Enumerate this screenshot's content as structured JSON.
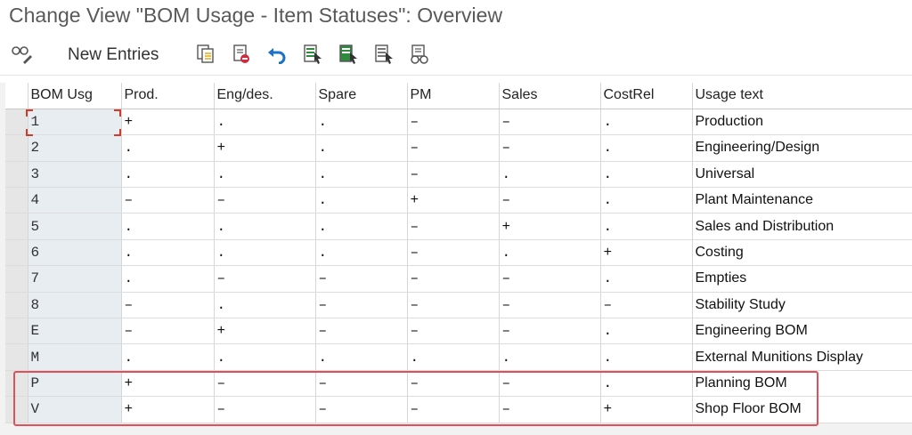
{
  "window": {
    "title": "Change View \"BOM Usage - Item Statuses\": Overview"
  },
  "toolbar": {
    "new_entries_label": "New Entries",
    "icons": [
      "display-change-icon",
      "copy-icon",
      "delete-icon",
      "undo-icon",
      "select-all-icon",
      "select-block-icon",
      "deselect-all-icon",
      "print-icon"
    ]
  },
  "table": {
    "columns": [
      "BOM Usg",
      "Prod.",
      "Eng/des.",
      "Spare",
      "PM",
      "Sales",
      "CostRel",
      "Usage text"
    ],
    "rows": [
      {
        "key": "1",
        "prod": "+",
        "eng": ".",
        "spare": ".",
        "pm": "–",
        "sales": "–",
        "cost": ".",
        "text": "Production"
      },
      {
        "key": "2",
        "prod": ".",
        "eng": "+",
        "spare": ".",
        "pm": "–",
        "sales": "–",
        "cost": ".",
        "text": "Engineering/Design"
      },
      {
        "key": "3",
        "prod": ".",
        "eng": ".",
        "spare": ".",
        "pm": "–",
        "sales": ".",
        "cost": ".",
        "text": "Universal"
      },
      {
        "key": "4",
        "prod": "–",
        "eng": "–",
        "spare": ".",
        "pm": "+",
        "sales": "–",
        "cost": ".",
        "text": "Plant Maintenance"
      },
      {
        "key": "5",
        "prod": ".",
        "eng": ".",
        "spare": ".",
        "pm": "–",
        "sales": "+",
        "cost": ".",
        "text": "Sales and Distribution"
      },
      {
        "key": "6",
        "prod": ".",
        "eng": ".",
        "spare": ".",
        "pm": "–",
        "sales": ".",
        "cost": "+",
        "text": "Costing"
      },
      {
        "key": "7",
        "prod": ".",
        "eng": "–",
        "spare": "–",
        "pm": "–",
        "sales": "–",
        "cost": ".",
        "text": "Empties"
      },
      {
        "key": "8",
        "prod": "–",
        "eng": ".",
        "spare": "–",
        "pm": "–",
        "sales": "–",
        "cost": "–",
        "text": "Stability Study"
      },
      {
        "key": "E",
        "prod": "–",
        "eng": "+",
        "spare": "–",
        "pm": "–",
        "sales": "–",
        "cost": ".",
        "text": "Engineering BOM"
      },
      {
        "key": "M",
        "prod": ".",
        "eng": ".",
        "spare": ".",
        "pm": ".",
        "sales": ".",
        "cost": ".",
        "text": "External Munitions Display"
      },
      {
        "key": "P",
        "prod": "+",
        "eng": "–",
        "spare": "–",
        "pm": "–",
        "sales": "–",
        "cost": ".",
        "text": "Planning BOM"
      },
      {
        "key": "V",
        "prod": "+",
        "eng": "–",
        "spare": "–",
        "pm": "–",
        "sales": "–",
        "cost": "+",
        "text": "Shop Floor BOM"
      }
    ]
  },
  "colors": {
    "highlight": "#e0505a",
    "focus": "#d13b2a",
    "key_column": "#e8edf1",
    "accent_icon": "#1a73c8",
    "green_icon": "#2e8b3d"
  }
}
